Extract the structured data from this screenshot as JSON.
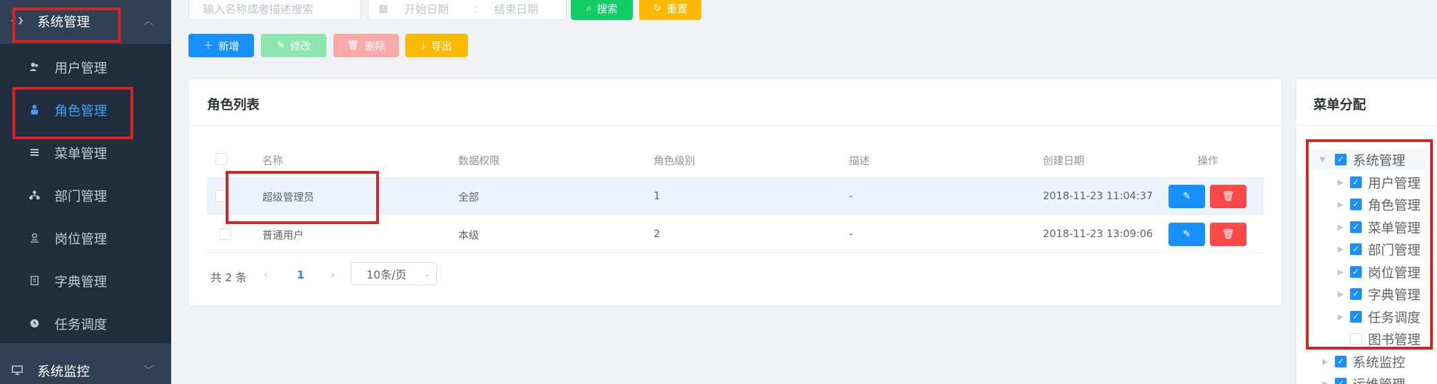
{
  "sidebar": {
    "group_system": "系统管理",
    "items": [
      {
        "label": "用户管理",
        "icon": "user-icon"
      },
      {
        "label": "角色管理",
        "icon": "role-icon"
      },
      {
        "label": "菜单管理",
        "icon": "menu-icon"
      },
      {
        "label": "部门管理",
        "icon": "dept-icon"
      },
      {
        "label": "岗位管理",
        "icon": "post-icon"
      },
      {
        "label": "字典管理",
        "icon": "dict-icon"
      },
      {
        "label": "任务调度",
        "icon": "task-icon"
      }
    ],
    "group_monitor": "系统监控"
  },
  "filters": {
    "search_placeholder": "输入名称或者描述搜索",
    "start_date_placeholder": "开始日期",
    "date_separator": ":",
    "end_date_placeholder": "结束日期",
    "search_button": "搜索",
    "reset_button": "重置"
  },
  "toolbar": {
    "add": "新增",
    "edit": "修改",
    "delete": "删除",
    "export": "导出"
  },
  "role_list": {
    "title": "角色列表",
    "columns": [
      "名称",
      "数据权限",
      "角色级别",
      "描述",
      "创建日期",
      "操作"
    ],
    "rows": [
      {
        "name": "超级管理员",
        "scope": "全部",
        "level": "1",
        "desc": "-",
        "created": "2018-11-23 11:04:37"
      },
      {
        "name": "普通用户",
        "scope": "本级",
        "level": "2",
        "desc": "-",
        "created": "2018-11-23 13:09:06"
      }
    ]
  },
  "pagination": {
    "total": "共 2 条",
    "current_page": "1",
    "page_size": "10条/页"
  },
  "menu_assign": {
    "title": "菜单分配",
    "tree": [
      {
        "label": "系统管理",
        "checked": true
      },
      {
        "label": "用户管理",
        "checked": true
      },
      {
        "label": "角色管理",
        "checked": true
      },
      {
        "label": "菜单管理",
        "checked": true
      },
      {
        "label": "部门管理",
        "checked": true
      },
      {
        "label": "岗位管理",
        "checked": true
      },
      {
        "label": "字典管理",
        "checked": true
      },
      {
        "label": "任务调度",
        "checked": true
      },
      {
        "label": "图书管理",
        "checked": false
      },
      {
        "label": "系统监控",
        "checked": true
      },
      {
        "label": "运维管理",
        "checked": true
      }
    ]
  },
  "colors": {
    "sidebar_bg": "#304156",
    "submenu_bg": "#1f2d3d",
    "primary": "#1890ff",
    "success": "#13ce66",
    "warning": "#ffba00",
    "danger": "#ff4949",
    "annotation": "#d9221f"
  }
}
